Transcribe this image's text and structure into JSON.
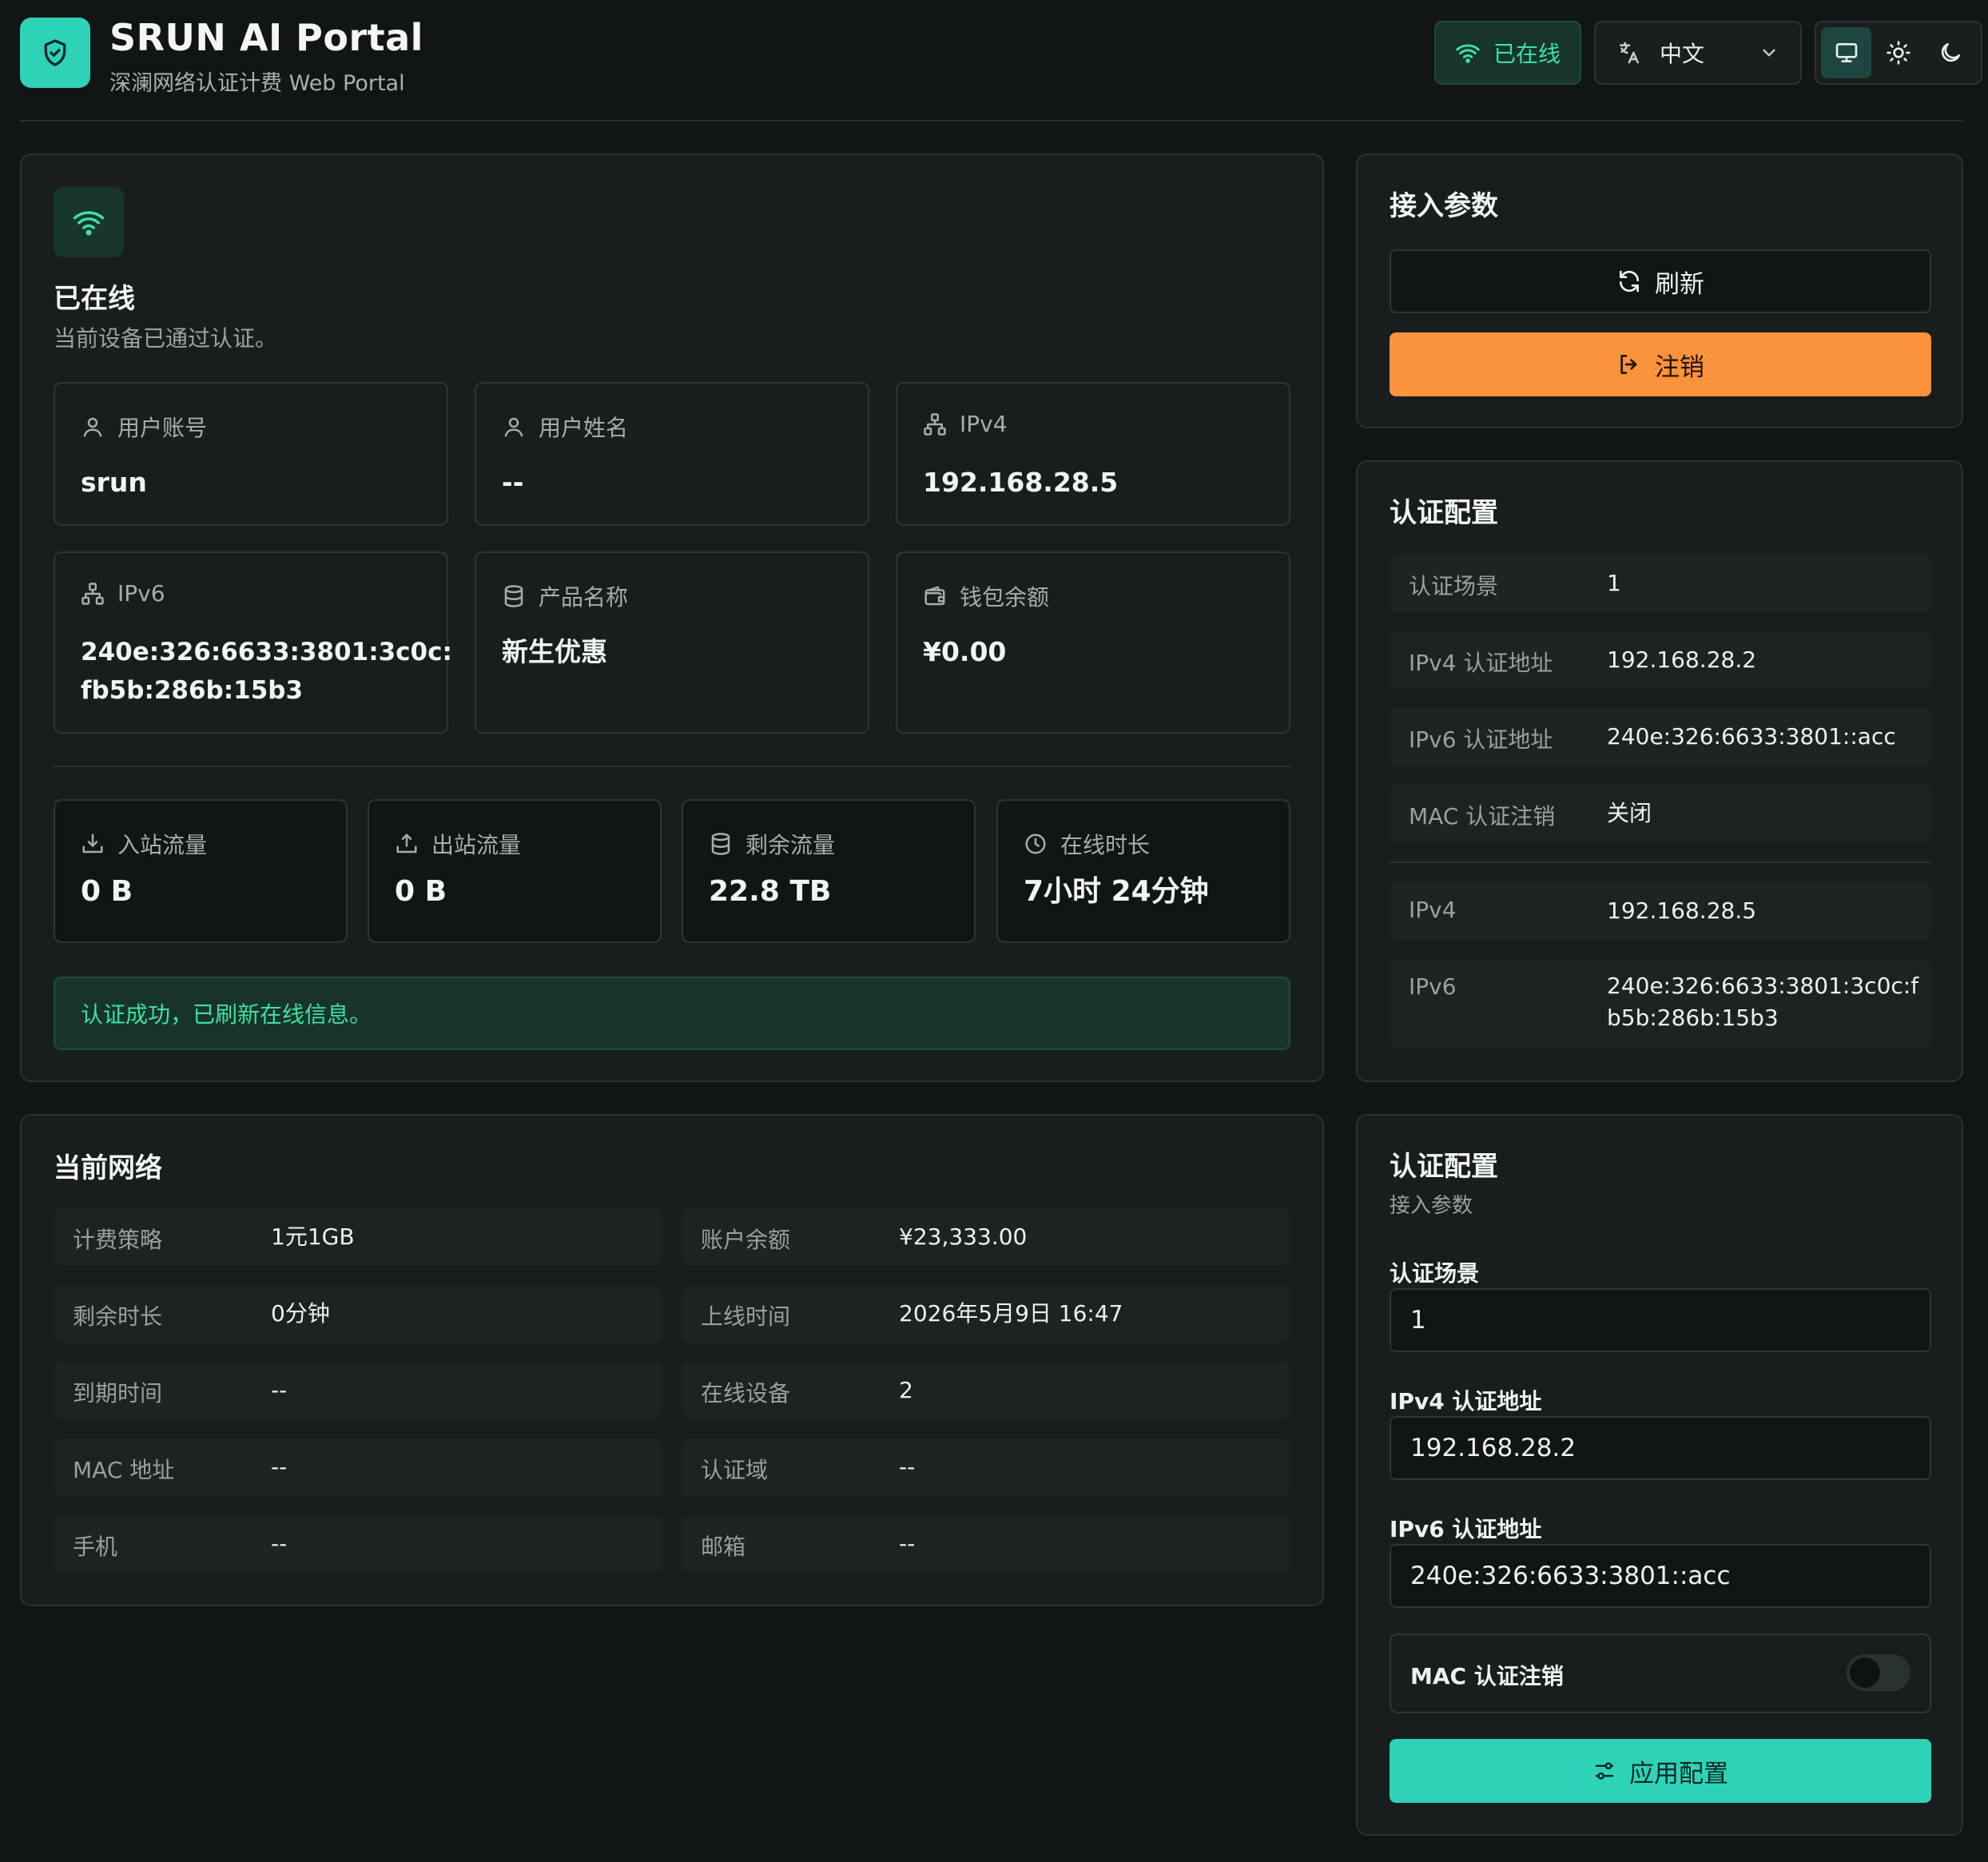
{
  "header": {
    "title": "SRUN AI Portal",
    "subtitle": "深澜网络认证计费 Web Portal",
    "status_label": "已在线",
    "language_label": "中文",
    "accent_color": "#2ed3b7"
  },
  "status_card": {
    "title": "已在线",
    "description": "当前设备已通过认证。",
    "tiles": [
      {
        "label": "用户账号",
        "value": "srun",
        "icon": "user-icon"
      },
      {
        "label": "用户姓名",
        "value": "--",
        "icon": "user-icon"
      },
      {
        "label": "IPv4",
        "value": "192.168.28.5",
        "icon": "network-icon"
      },
      {
        "label": "IPv6",
        "value_line1": "240e:326:6633:3801:3c0c:",
        "value_line2": "fb5b:286b:15b3",
        "icon": "network-icon"
      },
      {
        "label": "产品名称",
        "value": "新生优惠",
        "icon": "database-icon"
      },
      {
        "label": "钱包余额",
        "value": "¥0.00",
        "icon": "wallet-icon"
      }
    ],
    "stats": [
      {
        "label": "入站流量",
        "value": "0 B",
        "icon": "download-icon"
      },
      {
        "label": "出站流量",
        "value": "0 B",
        "icon": "upload-icon"
      },
      {
        "label": "剩余流量",
        "value": "22.8 TB",
        "icon": "database-icon"
      },
      {
        "label": "在线时长",
        "value": "7小时 24分钟",
        "icon": "clock-icon"
      }
    ],
    "message": "认证成功，已刷新在线信息。"
  },
  "access_card": {
    "title": "接入参数",
    "refresh_label": "刷新",
    "logout_label": "注销"
  },
  "auth_config_card": {
    "title": "认证配置",
    "rows": [
      {
        "key": "认证场景",
        "value": "1"
      },
      {
        "key": "IPv4 认证地址",
        "value": "192.168.28.2"
      },
      {
        "key": "IPv6 认证地址",
        "value": "240e:326:6633:3801::acc"
      },
      {
        "key": "MAC 认证注销",
        "value": "关闭"
      }
    ],
    "rows2": [
      {
        "key": "IPv4",
        "value": "192.168.28.5"
      },
      {
        "key": "IPv6",
        "value_line1": "240e:326:6633:3801:3c0c:f",
        "value_line2": "b5b:286b:15b3"
      }
    ]
  },
  "network_card": {
    "title": "当前网络",
    "left": [
      {
        "key": "计费策略",
        "value": "1元1GB"
      },
      {
        "key": "剩余时长",
        "value": "0分钟"
      },
      {
        "key": "到期时间",
        "value": "--"
      },
      {
        "key": "MAC 地址",
        "value": "--"
      },
      {
        "key": "手机",
        "value": "--"
      }
    ],
    "right": [
      {
        "key": "账户余额",
        "value": "¥23,333.00"
      },
      {
        "key": "上线时间",
        "value": "2026年5月9日 16:47"
      },
      {
        "key": "在线设备",
        "value": "2"
      },
      {
        "key": "认证域",
        "value": "--"
      },
      {
        "key": "邮箱",
        "value": "--"
      }
    ]
  },
  "config_form": {
    "title": "认证配置",
    "subtitle": "接入参数",
    "scene_label": "认证场景",
    "scene_value": "1",
    "ipv4_label": "IPv4 认证地址",
    "ipv4_value": "192.168.28.2",
    "ipv6_label": "IPv6 认证地址",
    "ipv6_value": "240e:326:6633:3801::acc",
    "mac_label": "MAC 认证注销",
    "mac_enabled": false,
    "apply_label": "应用配置"
  }
}
